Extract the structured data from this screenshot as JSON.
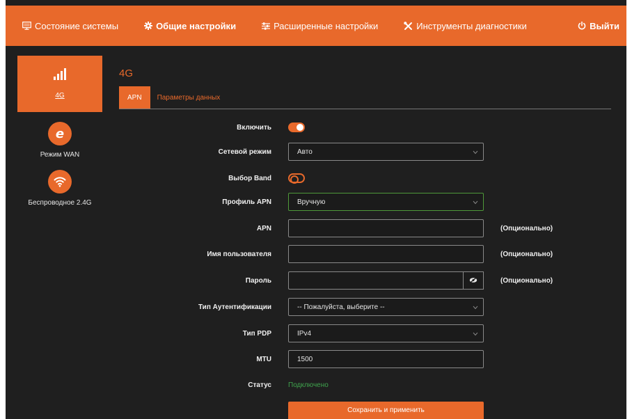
{
  "colors": {
    "accent": "#e8692b",
    "background": "#1f1f1f",
    "status_ok": "#3fa34d"
  },
  "nav": {
    "items": [
      {
        "label": "Состояние системы",
        "icon": "monitor-icon"
      },
      {
        "label": "Общие настройки",
        "icon": "gear-icon"
      },
      {
        "label": "Расширенные настройки",
        "icon": "sliders-icon"
      },
      {
        "label": "Инструменты диагностики",
        "icon": "tools-icon"
      }
    ],
    "logout": {
      "label": "Выйти",
      "icon": "power-icon"
    }
  },
  "sidebar": {
    "items": [
      {
        "label": "4G",
        "icon": "signal-bars-icon"
      },
      {
        "label": "Режим WAN",
        "icon": "internet-e-icon"
      },
      {
        "label": "Беспроводное 2.4G",
        "icon": "wifi-icon"
      }
    ]
  },
  "section": {
    "title": "4G"
  },
  "tabs": [
    {
      "label": "APN"
    },
    {
      "label": "Параметры данных"
    }
  ],
  "form": {
    "enable": {
      "label": "Включить",
      "state": "on"
    },
    "network_mode": {
      "label": "Сетевой режим",
      "value": "Авто"
    },
    "band_select": {
      "label": "Выбор Band",
      "state": "off"
    },
    "apn_profile": {
      "label": "Профиль APN",
      "value": "Вручную"
    },
    "apn": {
      "label": "APN",
      "value": "",
      "hint": "(Опционально)"
    },
    "username": {
      "label": "Имя пользователя",
      "value": "",
      "hint": "(Опционально)"
    },
    "password": {
      "label": "Пароль",
      "value": "",
      "hint": "(Опционально)"
    },
    "auth_type": {
      "label": "Тип Аутентификации",
      "value": "-- Пожалуйста, выберите --"
    },
    "pdp_type": {
      "label": "Тип PDP",
      "value": "IPv4"
    },
    "mtu": {
      "label": "MTU",
      "value": "1500"
    },
    "status": {
      "label": "Статус",
      "value": "Подключено"
    }
  },
  "actions": {
    "save_label": "Сохранить и применить"
  }
}
